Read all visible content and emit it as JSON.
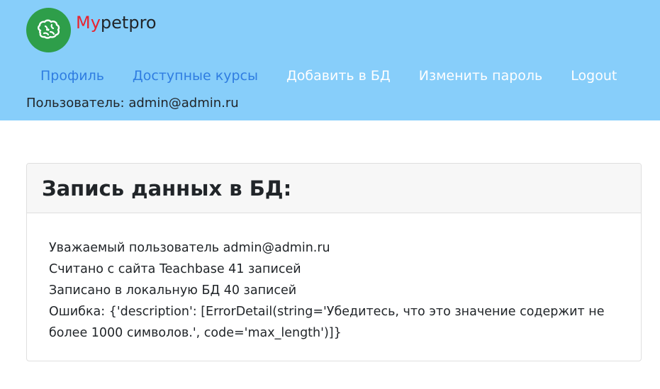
{
  "brand": {
    "accent": "My",
    "rest": "petpro",
    "logo_icon": "brain-icon",
    "logo_color": "#2e9e4a",
    "accent_color": "#e8232f"
  },
  "header": {
    "background": "#87cefa"
  },
  "nav": {
    "items": [
      {
        "label": "Профиль"
      },
      {
        "label": "Доступные курсы"
      },
      {
        "label": "Добавить в БД"
      },
      {
        "label": "Изменить пароль"
      },
      {
        "label": "Logout"
      }
    ],
    "link_color": "#2f7de1"
  },
  "user_line": "Пользователь: admin@admin.ru",
  "card": {
    "title": "Запись данных в БД:",
    "lines": [
      "Уважаемый пользователь admin@admin.ru",
      "Считано с сайта Teachbase 41 записей",
      "Записано в локальную БД 40 записей",
      "Ошибка: {'description': [ErrorDetail(string='Убедитесь, что это значение содержит не более 1000 символов.', code='max_length')]}"
    ]
  }
}
